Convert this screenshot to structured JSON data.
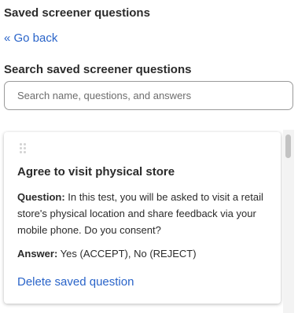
{
  "header": {
    "title": "Saved screener questions",
    "back_label": "« Go back"
  },
  "search": {
    "label": "Search saved screener questions",
    "placeholder": "Search name, questions, and answers",
    "value": ""
  },
  "saved_questions": [
    {
      "name": "Agree to visit physical store",
      "question_label": "Question:",
      "question_text": " In this test, you will be asked to visit a retail store's physical location and share feedback via your mobile phone. Do you consent?",
      "answer_label": "Answer:",
      "answer_text": " Yes (ACCEPT), No (REJECT)",
      "delete_label": "Delete saved question"
    }
  ],
  "icons": {
    "drag_handle": "drag-handle-icon"
  },
  "colors": {
    "link": "#2a64c9",
    "text": "#2b2b2b",
    "border": "#9a9a9a"
  }
}
